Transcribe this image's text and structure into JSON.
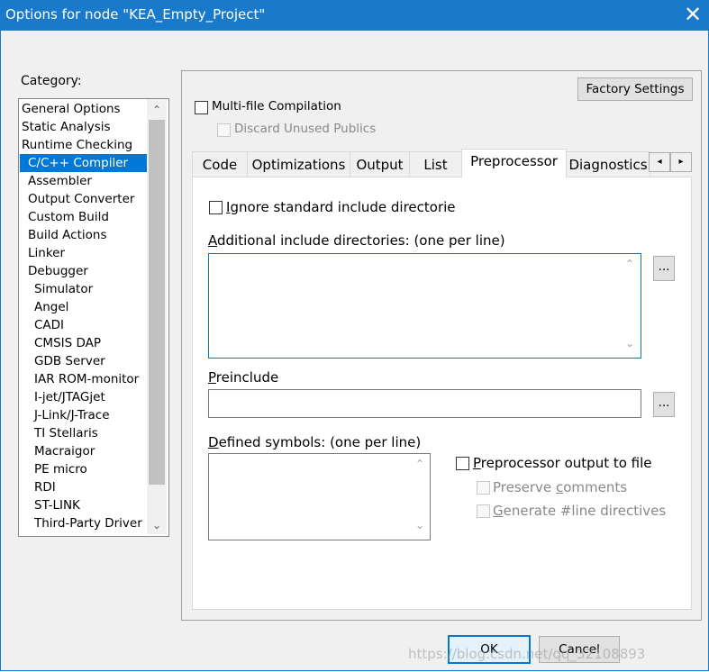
{
  "window": {
    "title": "Options for node \"KEA_Empty_Project\"",
    "close_glyph": "✕"
  },
  "category": {
    "label": "Category:",
    "items": [
      {
        "label": "General Options",
        "indent": 0
      },
      {
        "label": "Static Analysis",
        "indent": 0
      },
      {
        "label": "Runtime Checking",
        "indent": 0
      },
      {
        "label": "C/C++ Compiler",
        "indent": 1,
        "selected": true
      },
      {
        "label": "Assembler",
        "indent": 1
      },
      {
        "label": "Output Converter",
        "indent": 1
      },
      {
        "label": "Custom Build",
        "indent": 1
      },
      {
        "label": "Build Actions",
        "indent": 1
      },
      {
        "label": "Linker",
        "indent": 1
      },
      {
        "label": "Debugger",
        "indent": 1
      },
      {
        "label": "Simulator",
        "indent": 2
      },
      {
        "label": "Angel",
        "indent": 2
      },
      {
        "label": "CADI",
        "indent": 2
      },
      {
        "label": "CMSIS DAP",
        "indent": 2
      },
      {
        "label": "GDB Server",
        "indent": 2
      },
      {
        "label": "IAR ROM-monitor",
        "indent": 2
      },
      {
        "label": "I-jet/JTAGjet",
        "indent": 2
      },
      {
        "label": "J-Link/J-Trace",
        "indent": 2
      },
      {
        "label": "TI Stellaris",
        "indent": 2
      },
      {
        "label": "Macraigor",
        "indent": 2
      },
      {
        "label": "PE micro",
        "indent": 2
      },
      {
        "label": "RDI",
        "indent": 2
      },
      {
        "label": "ST-LINK",
        "indent": 2
      },
      {
        "label": "Third-Party Driver",
        "indent": 2
      }
    ],
    "scroll_up": "⌃",
    "scroll_down": "⌄"
  },
  "top_options": {
    "factory_settings": "Factory Settings",
    "multi_file": "Multi-file Compilation",
    "discard_unused": "Discard Unused Publics"
  },
  "tabs": {
    "items": [
      "Code",
      "Optimizations",
      "Output",
      "List",
      "Preprocessor",
      "Diagnostics"
    ],
    "active": "Preprocessor",
    "scroll_left": "◂",
    "scroll_right": "▸"
  },
  "preprocessor": {
    "ignore_std_first": "I",
    "ignore_std_rest": "gnore standard include directories",
    "additional_first": "A",
    "additional_rest": "dditional include directories: (one per line)",
    "additional_value": "",
    "browse_label": "...",
    "preinclude_first": "P",
    "preinclude_rest": "reinclude",
    "preinclude_value": "",
    "defined_first": "D",
    "defined_rest": "efined symbols: (one per line)",
    "defined_value": "",
    "pp_output_first": "P",
    "pp_output_rest": "reprocessor output to file",
    "preserve_comments_pre": "Preserve ",
    "preserve_comments_u": "c",
    "preserve_comments_post": "omments",
    "generate_line_first": "G",
    "generate_line_rest": "enerate #line directives"
  },
  "buttons": {
    "ok": "OK",
    "cancel": "Cancel"
  },
  "watermark": "https://blog.csdn.net/qq_32108893",
  "colors": {
    "title_bar": "#1979ca",
    "selection": "#0078d7"
  }
}
